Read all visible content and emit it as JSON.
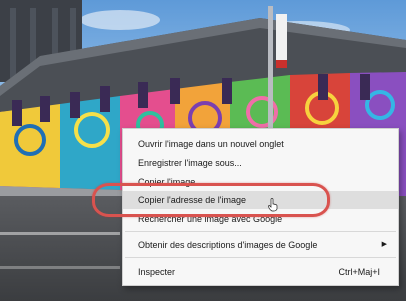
{
  "context_menu": {
    "items": [
      {
        "label": "Ouvrir l'image dans un nouvel onglet"
      },
      {
        "label": "Enregistrer l'image sous..."
      },
      {
        "label": "Copier l'image"
      },
      {
        "label": "Copier l'adresse de l'image"
      },
      {
        "label": "Rechercher une image avec Google"
      },
      {
        "label": "Obtenir des descriptions d'images de Google"
      },
      {
        "label": "Inspecter",
        "shortcut": "Ctrl+Maj+I"
      }
    ],
    "highlighted_item": "Copier l'adresse de l'image"
  },
  "colors": {
    "highlight_oval": "#d9534f",
    "menu_background": "#f7f7f7",
    "sky": "#7fb4e6"
  },
  "icons": {
    "submenu_arrow": "right-triangle-icon",
    "cursor": "hand-pointer-icon"
  }
}
